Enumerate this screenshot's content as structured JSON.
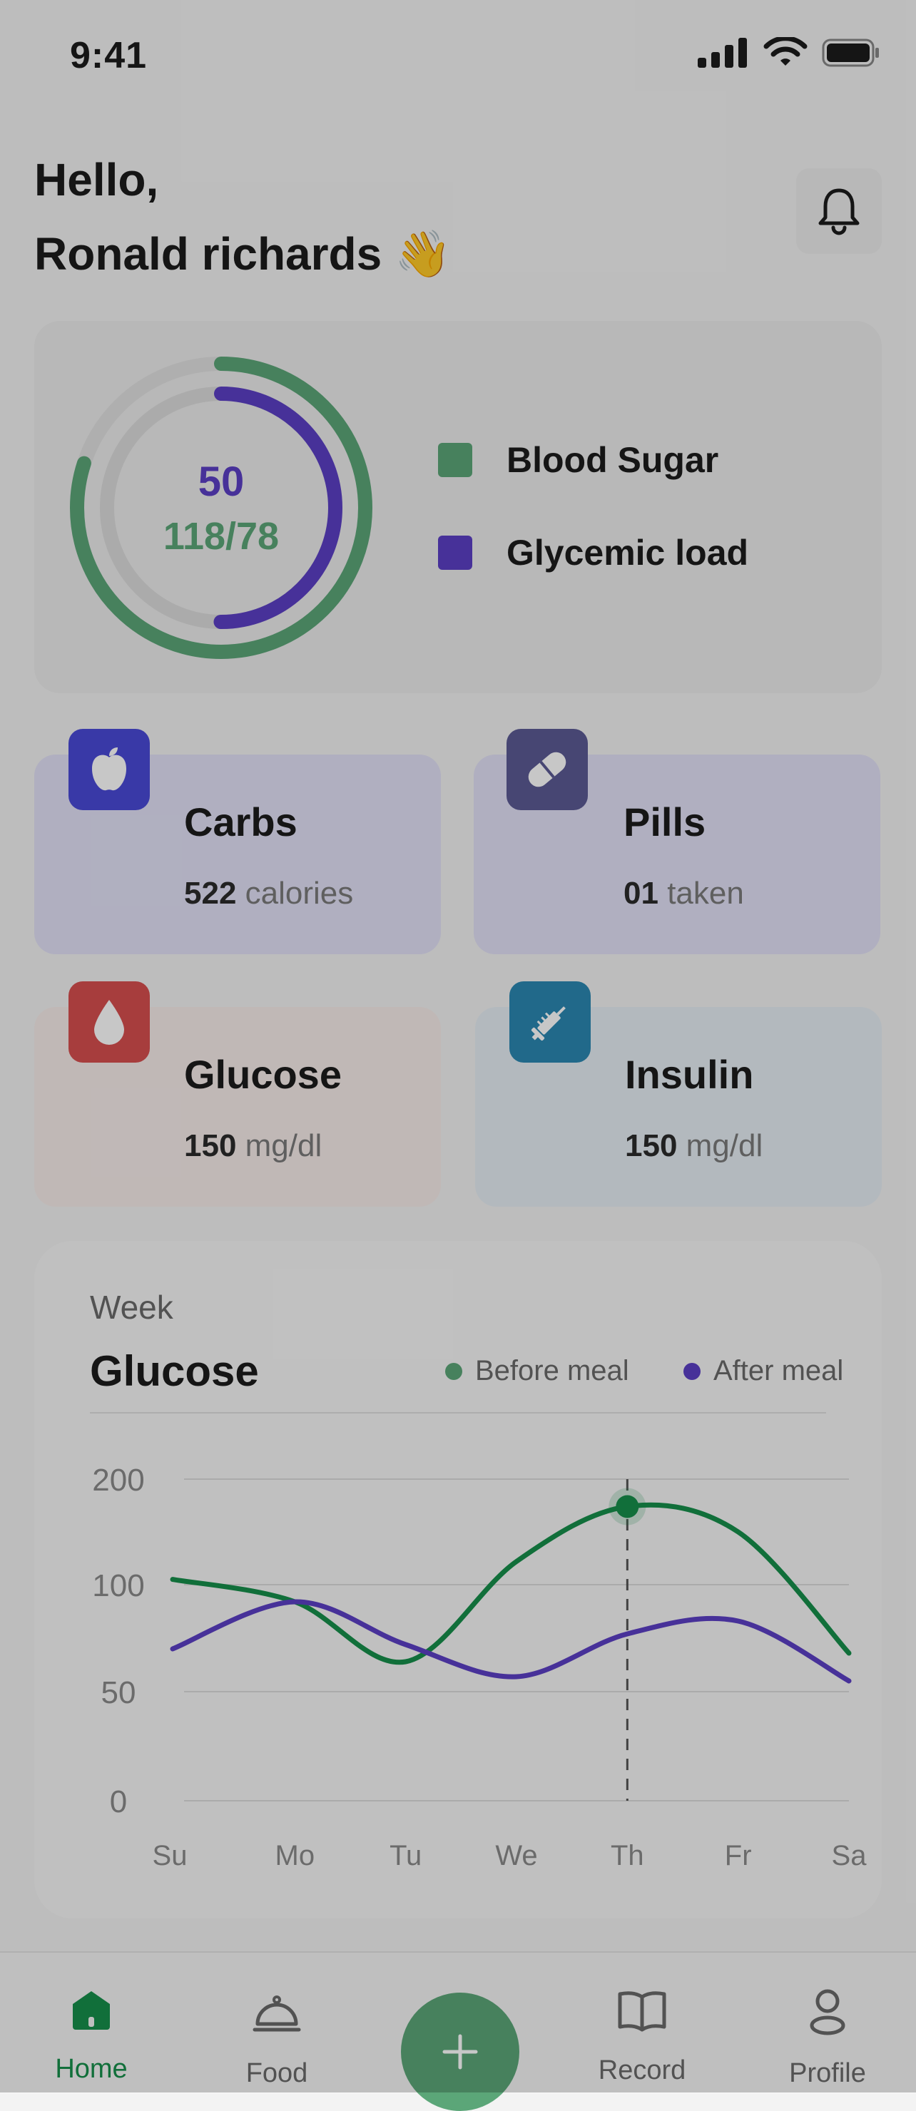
{
  "status_bar": {
    "time": "9:41"
  },
  "header": {
    "line1": "Hello,",
    "line2": "Ronald richards",
    "emoji": "👋"
  },
  "summary": {
    "value_top": "50",
    "value_bottom": "118/78",
    "legend": [
      {
        "label": "Blood Sugar",
        "color": "#5ba678"
      },
      {
        "label": "Glycemic load",
        "color": "#5b3fc4"
      }
    ]
  },
  "metrics": [
    {
      "title": "Carbs",
      "value": "522",
      "unit": "calories",
      "icon": "apple-icon",
      "icon_color": "#4a4ad6",
      "bg": "#e2e1f6"
    },
    {
      "title": "Pills",
      "value": "01",
      "unit": "taken",
      "icon": "pill-icon",
      "icon_color": "#5c5a94",
      "bg": "#e2e1f6"
    },
    {
      "title": "Glucose",
      "value": "150",
      "unit": "mg/dl",
      "icon": "drop-icon",
      "icon_color": "#d64f4f",
      "bg": "#f6ecea"
    },
    {
      "title": "Insulin",
      "value": "150",
      "unit": "mg/dl",
      "icon": "syringe-icon",
      "icon_color": "#2b87b1",
      "bg": "#e6eef4"
    }
  ],
  "chart": {
    "period": "Week",
    "title": "Glucose",
    "legend": [
      {
        "label": "Before meal",
        "color": "#168f4b"
      },
      {
        "label": "After meal",
        "color": "#5b3fc4"
      }
    ]
  },
  "chart_data": {
    "type": "line",
    "categories": [
      "Su",
      "Mo",
      "Tu",
      "We",
      "Th",
      "Fr",
      "Sa"
    ],
    "y_ticks": [
      "200",
      "100",
      "50",
      "0"
    ],
    "series": [
      {
        "name": "Before meal",
        "values": [
          105,
          92,
          64,
          122,
          174,
          150,
          68
        ]
      },
      {
        "name": "After meal",
        "values": [
          70,
          92,
          72,
          57,
          77,
          83,
          55
        ]
      }
    ],
    "highlight_category": "Th",
    "grid": true
  },
  "nav": {
    "items": [
      {
        "label": "Home",
        "icon": "home-icon"
      },
      {
        "label": "Food",
        "icon": "food-cloche-icon"
      },
      {
        "label": "Record",
        "icon": "book-icon"
      },
      {
        "label": "Profile",
        "icon": "person-icon"
      }
    ],
    "add_icon": "plus-icon"
  }
}
